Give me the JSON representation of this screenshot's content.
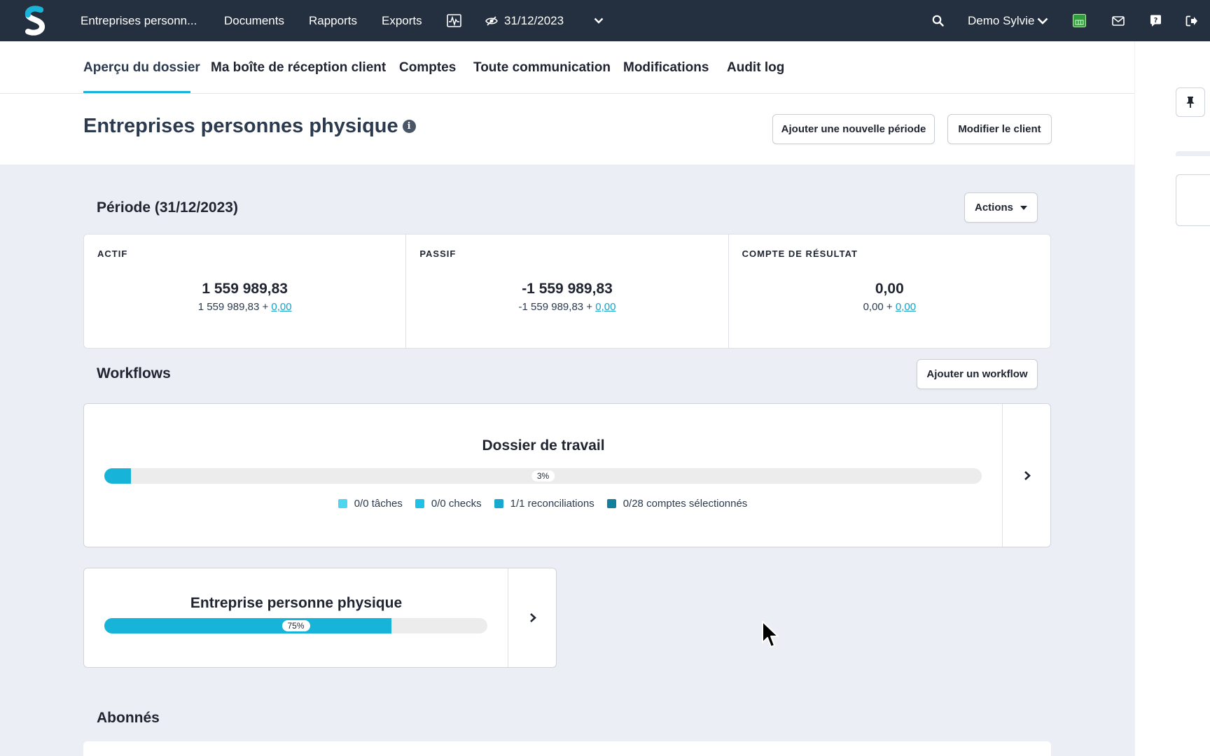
{
  "topbar": {
    "client_short": "Entreprises personn...",
    "nav": [
      "Documents",
      "Rapports",
      "Exports"
    ],
    "period_date": "31/12/2023",
    "user_name": "Demo Sylvie",
    "icons": [
      "activity-chart-icon",
      "eye-slash-icon",
      "chevron-down-icon",
      "search-icon",
      "user-chevron-icon",
      "spreadsheet-icon",
      "mail-icon",
      "help-icon",
      "logout-icon"
    ],
    "colors": {
      "bg": "#243040",
      "accent": "#17b3d8",
      "excel_green": "#2e9e3e"
    }
  },
  "tabs": {
    "items": [
      "Aperçu du dossier",
      "Ma boîte de réception client",
      "Comptes",
      "Toute communication",
      "Modifications",
      "Audit log"
    ],
    "active": "Aperçu du dossier"
  },
  "header": {
    "title": "Entreprises personnes physique",
    "add_period_label": "Ajouter une nouvelle période",
    "edit_client_label": "Modifier le client"
  },
  "period": {
    "title": "Période (31/12/2023)",
    "actions_label": "Actions"
  },
  "balances": [
    {
      "label": "ACTIF",
      "value": "1 559 989,83",
      "base": "1 559 989,83 +",
      "delta": "0,00"
    },
    {
      "label": "PASSIF",
      "value": "-1 559 989,83",
      "base": "-1 559 989,83 +",
      "delta": "0,00"
    },
    {
      "label": "COMPTE DE RÉSULTAT",
      "value": "0,00",
      "base": "0,00 +",
      "delta": "0,00"
    }
  ],
  "workflows": {
    "title": "Workflows",
    "add_label": "Ajouter un workflow",
    "items": [
      {
        "title": "Dossier de travail",
        "progress_pct": 3,
        "progress_label": "3%",
        "legend": [
          {
            "text": "0/0 tâches",
            "color": "#4fd6ef"
          },
          {
            "text": "0/0 checks",
            "color": "#1fc2e6"
          },
          {
            "text": "1/1 reconciliations",
            "color": "#17a9cf"
          },
          {
            "text": "0/28 comptes sélectionnés",
            "color": "#127f9c"
          }
        ]
      },
      {
        "title": "Entreprise personne physique",
        "progress_pct": 75,
        "progress_label": "75%"
      }
    ]
  },
  "subscribers": {
    "title": "Abonnés"
  }
}
